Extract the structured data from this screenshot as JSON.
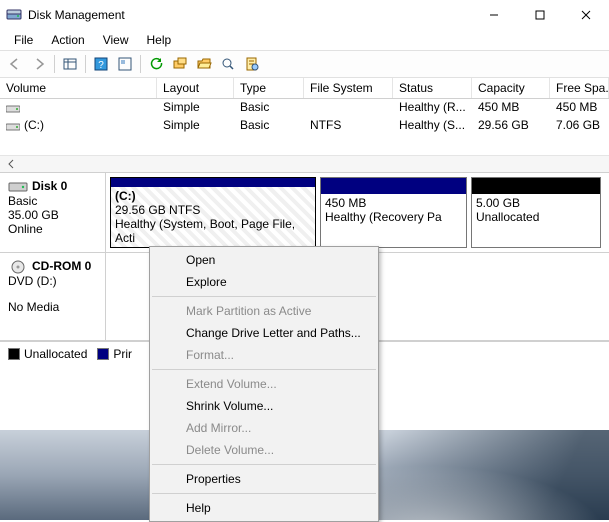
{
  "window": {
    "title": "Disk Management"
  },
  "menubar": [
    "File",
    "Action",
    "View",
    "Help"
  ],
  "list": {
    "headers": [
      "Volume",
      "Layout",
      "Type",
      "File System",
      "Status",
      "Capacity",
      "Free Spa..."
    ],
    "rows": [
      {
        "vol": "",
        "lay": "Simple",
        "typ": "Basic",
        "fs": "",
        "sta": "Healthy (R...",
        "cap": "450 MB",
        "free": "450 MB"
      },
      {
        "vol": "(C:)",
        "lay": "Simple",
        "typ": "Basic",
        "fs": "NTFS",
        "sta": "Healthy (S...",
        "cap": "29.56 GB",
        "free": "7.06 GB"
      }
    ]
  },
  "disks": [
    {
      "name": "Disk 0",
      "type": "Basic",
      "size": "35.00 GB",
      "state": "Online",
      "parts": [
        {
          "label": "(C:)",
          "line2": "29.56 GB NTFS",
          "line3": "Healthy (System, Boot, Page File, Acti",
          "selected": true,
          "kind": "primary"
        },
        {
          "label": "",
          "line2": "450 MB",
          "line3": "Healthy (Recovery Pa",
          "kind": "primary"
        },
        {
          "label": "",
          "line2": "5.00 GB",
          "line3": "Unallocated",
          "kind": "unallocated"
        }
      ]
    },
    {
      "name": "CD-ROM 0",
      "type": "DVD (D:)",
      "size": "",
      "state": "No Media",
      "parts": []
    }
  ],
  "legend": {
    "unallocated": "Unallocated",
    "primary": "Prir"
  },
  "context_menu": [
    {
      "label": "Open",
      "enabled": true
    },
    {
      "label": "Explore",
      "enabled": true
    },
    {
      "sep": true
    },
    {
      "label": "Mark Partition as Active",
      "enabled": false
    },
    {
      "label": "Change Drive Letter and Paths...",
      "enabled": true
    },
    {
      "label": "Format...",
      "enabled": false
    },
    {
      "sep": true
    },
    {
      "label": "Extend Volume...",
      "enabled": false
    },
    {
      "label": "Shrink Volume...",
      "enabled": true
    },
    {
      "label": "Add Mirror...",
      "enabled": false
    },
    {
      "label": "Delete Volume...",
      "enabled": false
    },
    {
      "sep": true
    },
    {
      "label": "Properties",
      "enabled": true
    },
    {
      "sep": true
    },
    {
      "label": "Help",
      "enabled": true
    }
  ]
}
